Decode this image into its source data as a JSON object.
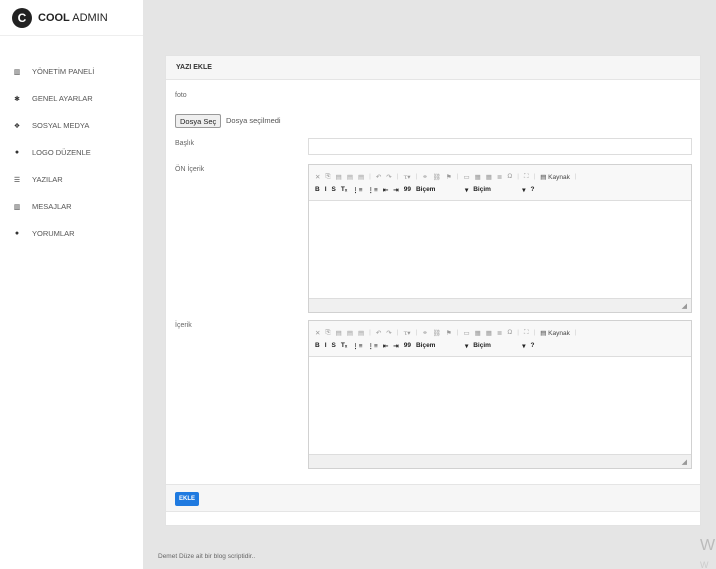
{
  "brand": {
    "badge": "C",
    "name_bold": "COOL",
    "name_rest": " ADMIN"
  },
  "sidebar": {
    "items": [
      {
        "label": "YÖNETİM PANELİ",
        "icon": "chart-icon",
        "glyph": "▥"
      },
      {
        "label": "GENEL AYARLAR",
        "icon": "gear-icon",
        "glyph": "✱"
      },
      {
        "label": "SOSYAL MEDYA",
        "icon": "share-icon",
        "glyph": "❖"
      },
      {
        "label": "LOGO DÜZENLE",
        "icon": "image-icon",
        "glyph": "●"
      },
      {
        "label": "YAZILAR",
        "icon": "list-icon",
        "glyph": "☰"
      },
      {
        "label": "MESAJLAR",
        "icon": "chart-icon",
        "glyph": "▥"
      },
      {
        "label": "YORUMLAR",
        "icon": "comment-icon",
        "glyph": "●"
      }
    ]
  },
  "form": {
    "title": "YAZI EKLE",
    "foto_label": "foto",
    "file_button": "Dosya Seç",
    "file_status": "Dosya seçilmedi",
    "baslik_label": "Başlık",
    "on_icerik_label": "ÖN İçerik",
    "icerik_label": "İçerik",
    "submit": "EKLE"
  },
  "editor": {
    "row1": [
      "✕",
      "⎘",
      "▤",
      "▤",
      "▤",
      "|",
      "↶",
      "↷",
      "|",
      "ꚍ▾",
      "|",
      "⚭",
      "⛓",
      "⚑",
      "|",
      "▭",
      "▦",
      "▦",
      "≣",
      "Ω",
      "|",
      "⛶",
      "|",
      "▤ Kaynak",
      "|"
    ],
    "row2_b": "B",
    "row2_i": "I",
    "row2_s": "S",
    "row2_tx": "Tₓ",
    "row2_lists": [
      "⋮≡",
      "⋮≡",
      "⇤",
      "⇥",
      "99"
    ],
    "format1": "Biçem",
    "format2": "Biçim",
    "help": "?",
    "grip": "◢"
  },
  "footer": {
    "text": "Demet Düze ait bir blog scriptidir.."
  },
  "watermark": {
    "line1": "W",
    "line2": "W"
  }
}
